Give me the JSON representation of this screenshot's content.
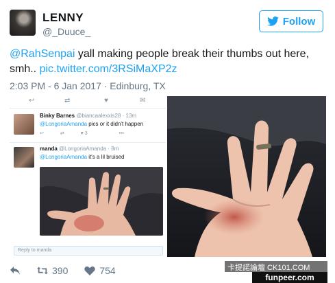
{
  "header": {
    "display_name": "LENNY",
    "handle": "@_Duuce_",
    "follow_label": "Follow"
  },
  "tweet": {
    "mention": "@RahSenpai",
    "text": " yall making people break their thumbs out here, smh.. ",
    "link": "pic.twitter.com/3RSiMaXP2z",
    "meta": "2:03 PM - 6 Jan 2017 · Edinburg, TX"
  },
  "embedded": {
    "reply1": {
      "name": "Binky Barnes",
      "handle": "@biancaalexxis28 · 13m",
      "mention": "@LongoriaAmanda",
      "text": " pics or it didn't happen",
      "retweets": "",
      "likes": "3"
    },
    "reply2": {
      "name": "manda",
      "handle": "@LongoriaAmanda · 8m",
      "mention": "@LongoriaAmanda",
      "text": " it's a lil bruised"
    },
    "reply_placeholder": "Reply to manda"
  },
  "actions": {
    "retweets": "390",
    "likes": "754"
  },
  "watermark": {
    "line1": "卡提諾論壇 CK101.COM",
    "line2": "funpeer.com"
  },
  "colors": {
    "accent": "#1da1f2",
    "muted": "#657786"
  }
}
